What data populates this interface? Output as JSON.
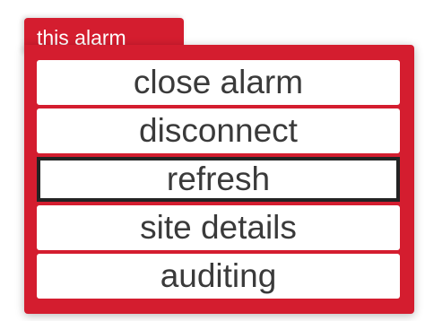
{
  "menu": {
    "title": "this alarm",
    "items": [
      {
        "label": "close alarm"
      },
      {
        "label": "disconnect"
      },
      {
        "label": "refresh",
        "selected": true
      },
      {
        "label": "site details"
      },
      {
        "label": "auditing"
      }
    ]
  },
  "colors": {
    "panel_red": "#d41d2f",
    "item_background": "#ffffff",
    "item_text": "#3a3a3a",
    "selection_border": "#232323"
  }
}
